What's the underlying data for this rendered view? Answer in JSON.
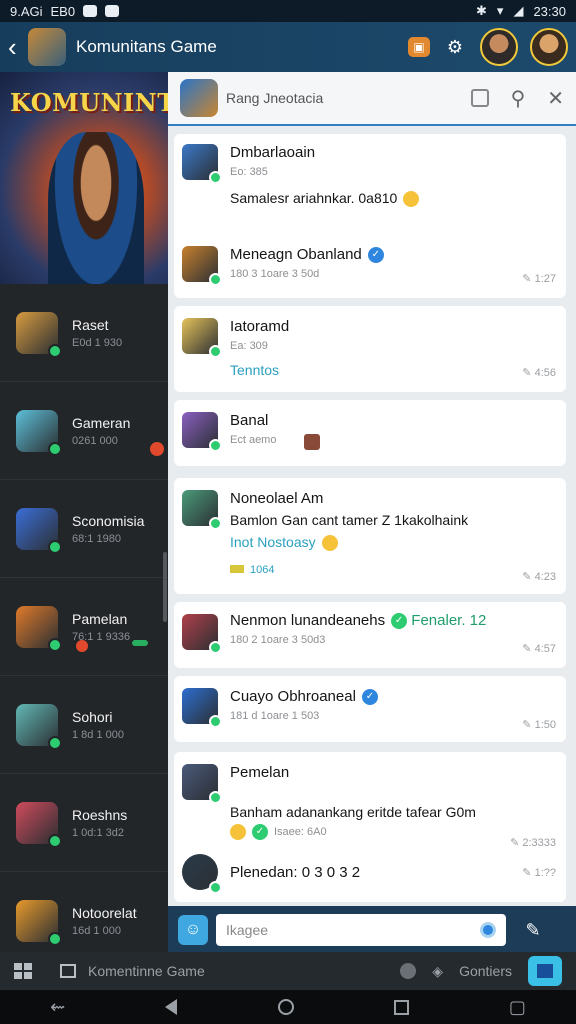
{
  "status_bar": {
    "time_left": "9.AGi",
    "carrier": "EB0",
    "time_right": "23:30"
  },
  "app_bar": {
    "title": "Komunitans Game"
  },
  "hero": {
    "title": "KOMUNINTAN"
  },
  "sidebar": {
    "items": [
      {
        "name": "Raset",
        "meta": "E0d 1 930",
        "avatar_color": "#d89b3f"
      },
      {
        "name": "Gameran",
        "meta": "0261 000",
        "avatar_color": "#5dc0d9"
      },
      {
        "name": "Sconomisia",
        "meta": "68:1 1980",
        "avatar_color": "#3b6ed8"
      },
      {
        "name": "Pamelan",
        "meta": "76:1 1 9336",
        "avatar_color": "#e07a2a"
      },
      {
        "name": "Sohori",
        "meta": "1 8d 1 000",
        "avatar_color": "#61b8b5"
      },
      {
        "name": "Roeshns",
        "meta": "1 0d:1 3d2",
        "avatar_color": "#d04b5c"
      },
      {
        "name": "Notoorelat",
        "meta": "16d 1 000",
        "avatar_color": "#e89a2c"
      }
    ]
  },
  "chat_header": {
    "title": "Rang Jneotacia"
  },
  "messages": [
    {
      "name": "Dmbarlaoain",
      "meta": "Eo: 385",
      "body": "Samalesr ariahnkar. 0a810",
      "time": "",
      "avatar_color": "#3b78c9"
    },
    {
      "name": "Meneagn Obanland",
      "meta": "180 3 1oare 3 50d",
      "time": "1:27",
      "avatar_color": "#c9802e"
    },
    {
      "name": "Iatoramd",
      "meta": "Ea: 309",
      "link": "Tenntos",
      "time": "4:56",
      "avatar_color": "#e5c35a"
    },
    {
      "name": "Banal",
      "meta": "Ect aemo",
      "time": "",
      "avatar_color": "#8a5fc2"
    },
    {
      "name": "Noneolael Am",
      "body": "Bamlon Gan cant tamer Z 1kakolhaink",
      "link": "Inot Nostoasy",
      "extra": "1064",
      "time": "4:23",
      "avatar_color": "#4b9b7a"
    },
    {
      "name": "Nenmon lunandeanehs",
      "extra": "Fenaler. 12",
      "meta": "180 2 1oare 3 50d3",
      "time": "4:57",
      "avatar_color": "#b0404a"
    },
    {
      "name": "Cuayo Obhroaneal",
      "meta": "181 d 1oare 1 503",
      "time": "1:50",
      "avatar_color": "#2d6ed0"
    },
    {
      "name": "Pemelan",
      "body": "Banham adanankang eritde tafear G0m",
      "extra": "Isaee: 6A0",
      "time": "2:3333",
      "avatar_color": "#4a5a7a"
    },
    {
      "name": "Plenedan: 0 3 0 3 2",
      "time": "1:??",
      "avatar_color": "#2a3b4a"
    }
  ],
  "composer": {
    "placeholder": "Ikagee"
  },
  "tab_bar": {
    "left_label": "Komentinne Game",
    "right_label": "Gontiers"
  }
}
